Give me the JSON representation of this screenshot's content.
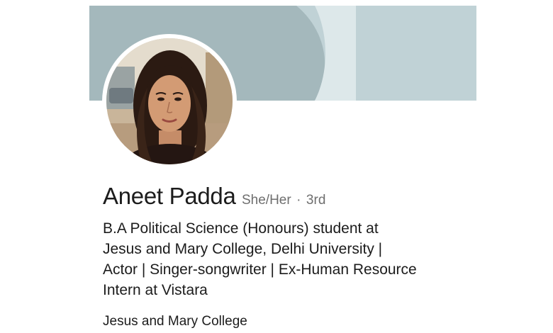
{
  "profile": {
    "name": "Aneet Padda",
    "pronouns": "She/Her",
    "separator": "·",
    "connection_degree": "3rd",
    "headline_lines": [
      "B.A Political Science (Honours) student at",
      "Jesus and Mary College, Delhi University |",
      "Actor | Singer-songwriter | Ex-Human Resource",
      "Intern at Vistara"
    ],
    "organization": "Jesus and Mary College"
  },
  "colors": {
    "cover_dark": "#a4b8bc",
    "cover_light": "#c0d2d6",
    "cover_stripe": "#dde8ea",
    "text_primary": "#1c1c1c",
    "text_secondary": "#6e6e6e"
  }
}
